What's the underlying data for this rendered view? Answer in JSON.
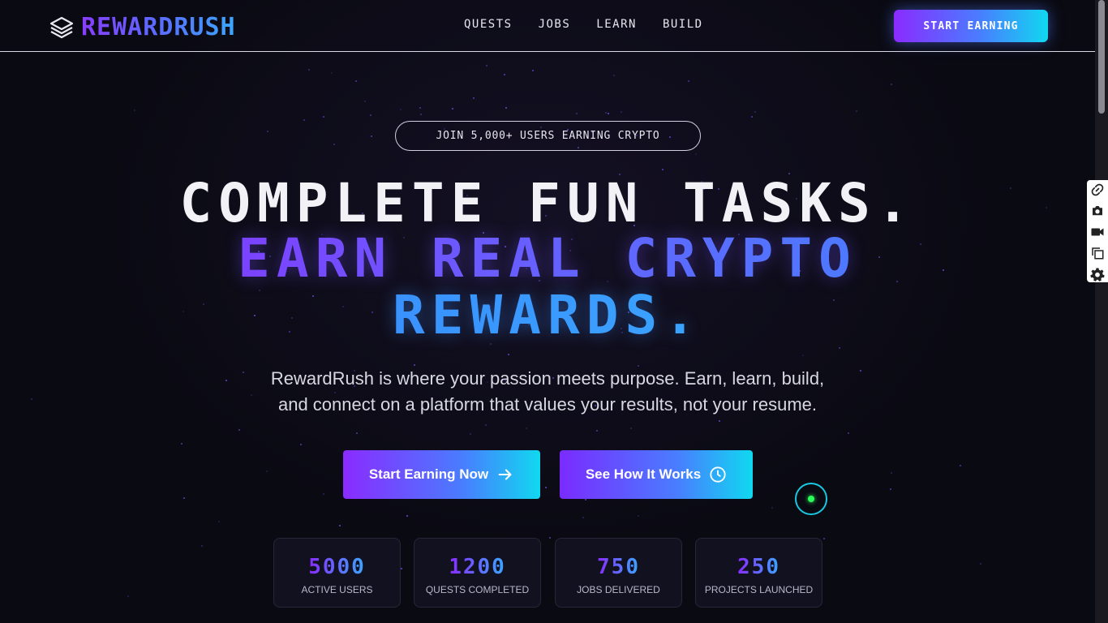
{
  "brand": {
    "name": "REWARDRUSH",
    "logo_icon": "layers-icon"
  },
  "nav": {
    "items": [
      "QUESTS",
      "JOBS",
      "LEARN",
      "BUILD"
    ]
  },
  "header": {
    "cta_label": "START EARNING"
  },
  "hero": {
    "badge": "JOIN 5,000+ USERS EARNING CRYPTO",
    "line1": "COMPLETE FUN TASKS.",
    "line2": "EARN REAL CRYPTO",
    "line3": "REWARDS.",
    "subtitle_line1": "RewardRush is where your passion meets purpose. Earn, learn, build,",
    "subtitle_line2": "and connect on a platform that values your results, not your resume.",
    "primary_button": "Start Earning Now",
    "primary_icon": "arrow-right-icon",
    "secondary_button": "See How It Works",
    "secondary_icon": "clock-icon"
  },
  "stats": [
    {
      "value": "5000",
      "label": "ACTIVE USERS"
    },
    {
      "value": "1200",
      "label": "QUESTS COMPLETED"
    },
    {
      "value": "750",
      "label": "JOBS DELIVERED"
    },
    {
      "value": "250",
      "label": "PROJECTS LAUNCHED"
    }
  ],
  "tool_panel": {
    "icons": [
      "link-icon",
      "camera-icon",
      "video-icon",
      "copy-icon",
      "gear-icon"
    ]
  },
  "colors": {
    "background": "#0a0a12",
    "accent_purple": "#8a2bff",
    "accent_blue": "#3aa8ff",
    "accent_cyan": "#10d8f0",
    "status_green": "#2bff5a"
  }
}
